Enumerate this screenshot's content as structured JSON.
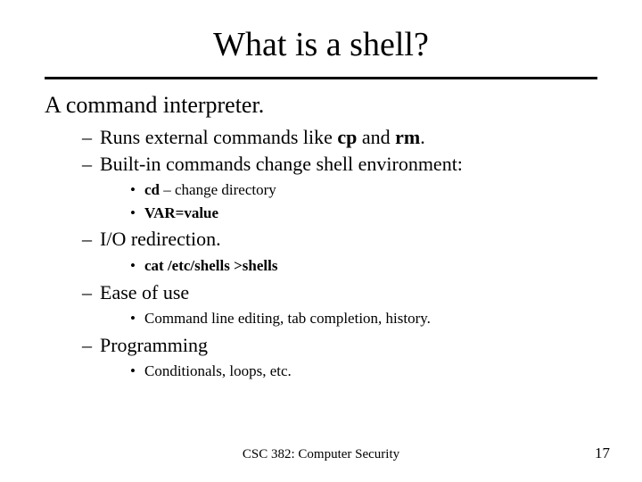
{
  "title": "What is a shell?",
  "subtitle": "A command interpreter.",
  "items": [
    {
      "prefix": "Runs external commands like ",
      "b1": "cp",
      "mid": " and ",
      "b2": "rm",
      "suffix": "."
    },
    {
      "text": "Built-in commands change shell environment:",
      "sub": [
        {
          "b": "cd",
          "rest": " – change directory"
        },
        {
          "b": "VAR=value",
          "rest": ""
        }
      ]
    },
    {
      "text": "I/O redirection.",
      "sub": [
        {
          "b": "cat /etc/shells >shells",
          "rest": ""
        }
      ]
    },
    {
      "text": "Ease of use",
      "sub": [
        {
          "b": "",
          "rest": "Command line editing, tab completion, history."
        }
      ]
    },
    {
      "text": "Programming",
      "sub": [
        {
          "b": "",
          "rest": "Conditionals, loops, etc."
        }
      ]
    }
  ],
  "footer": {
    "center": "CSC 382: Computer Security",
    "page": "17"
  }
}
